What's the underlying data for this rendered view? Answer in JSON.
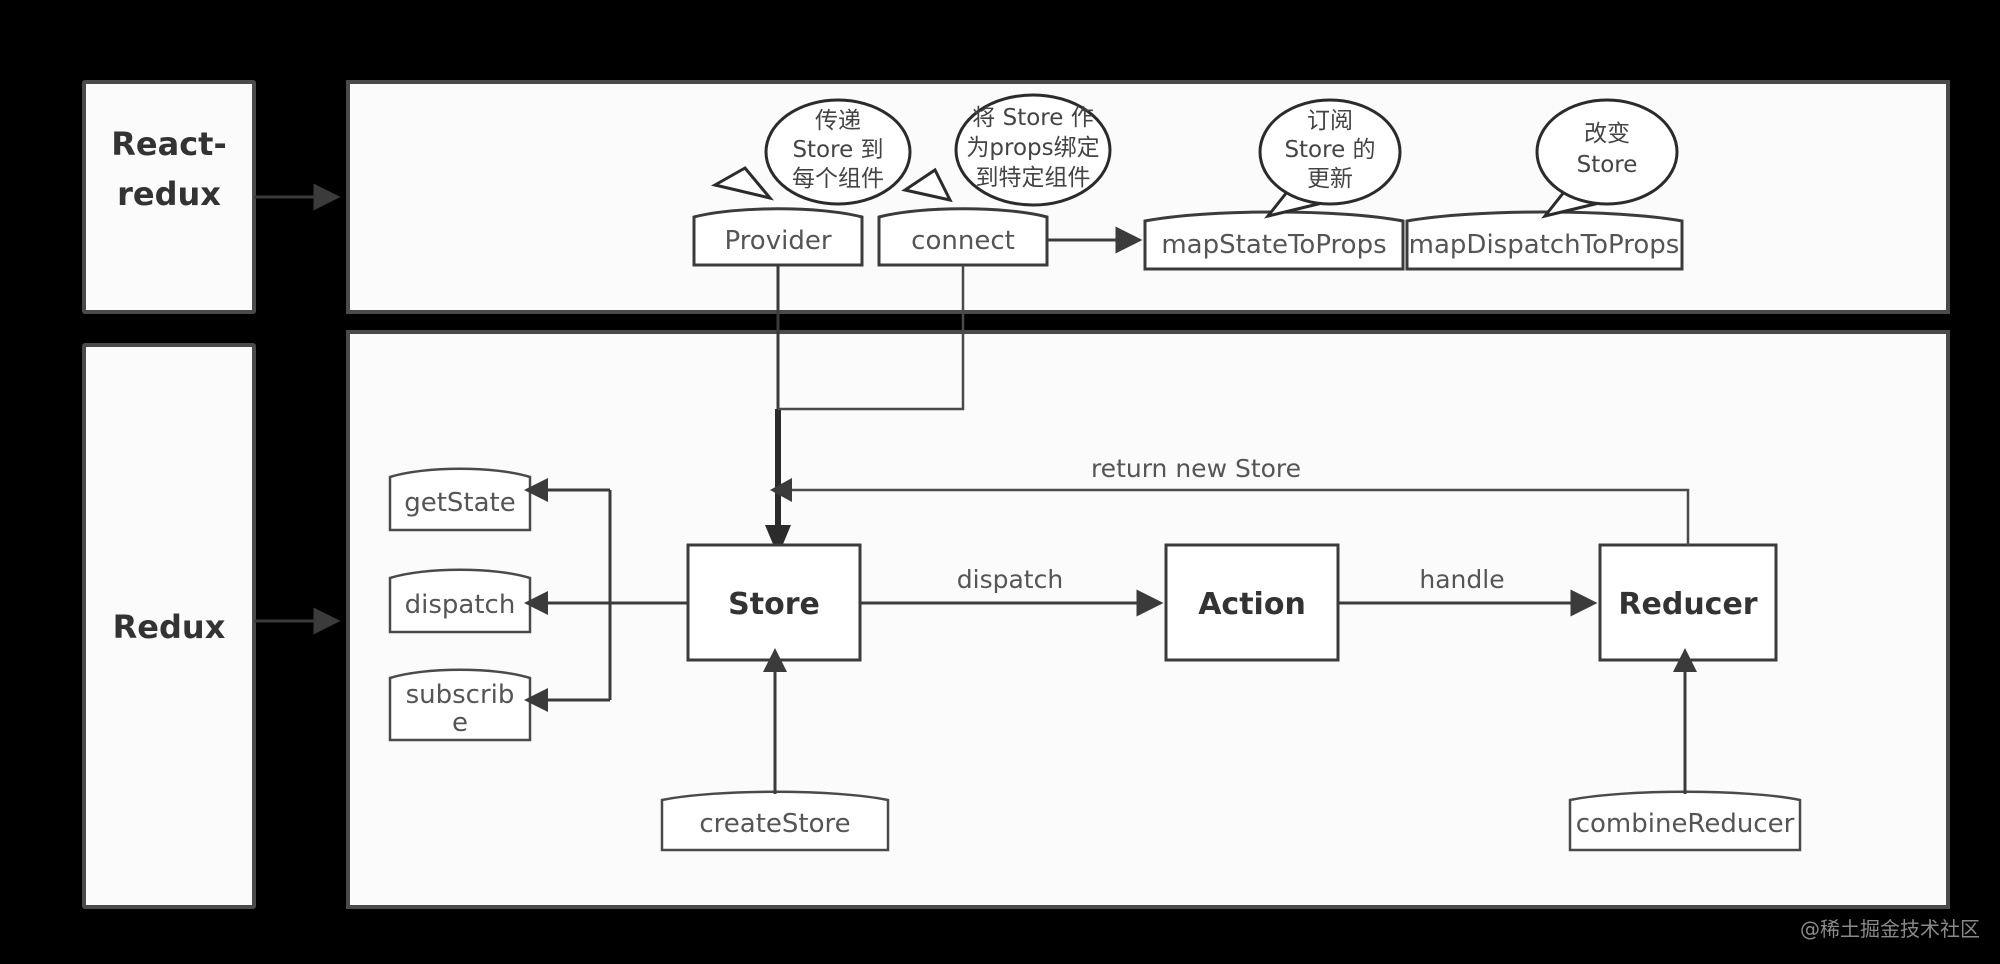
{
  "sections": [
    {
      "id": "react-redux",
      "label_line1": "React-",
      "label_line2": "redux"
    },
    {
      "id": "redux",
      "label_line1": "Redux",
      "label_line2": ""
    }
  ],
  "callouts": [
    {
      "id": "provider-note",
      "lines": [
        "传递",
        "Store 到",
        "每个组件"
      ]
    },
    {
      "id": "connect-note",
      "lines": [
        "将 Store 作",
        "为props绑定",
        "到特定组件"
      ]
    },
    {
      "id": "mapstate-note",
      "lines": [
        "订阅",
        "Store 的",
        "更新"
      ]
    },
    {
      "id": "mapdispatch-note",
      "lines": [
        "改变",
        "Store"
      ]
    }
  ],
  "react_redux_nodes": [
    {
      "id": "provider",
      "label": "Provider"
    },
    {
      "id": "connect",
      "label": "connect"
    },
    {
      "id": "mapStateToProps",
      "label": "mapStateToProps"
    },
    {
      "id": "mapDispatchToProps",
      "label": "mapDispatchToProps"
    }
  ],
  "redux_api_nodes": [
    {
      "id": "getState",
      "label": "getState"
    },
    {
      "id": "dispatch",
      "label": "dispatch"
    },
    {
      "id": "subscribe",
      "label_line1": "subscrib",
      "label_line2": "e"
    }
  ],
  "redux_flow_nodes": [
    {
      "id": "store",
      "label": "Store"
    },
    {
      "id": "action",
      "label": "Action"
    },
    {
      "id": "reducer",
      "label": "Reducer"
    }
  ],
  "redux_factory_nodes": [
    {
      "id": "createStore",
      "label": "createStore"
    },
    {
      "id": "combineReducer",
      "label": "combineReducer"
    }
  ],
  "edge_labels": [
    {
      "id": "dispatch-edge",
      "label": "dispatch"
    },
    {
      "id": "handle-edge",
      "label": "handle"
    },
    {
      "id": "return-edge",
      "label": "return new Store"
    }
  ],
  "watermark": {
    "text": "@稀土掘金技术社区"
  },
  "colors": {
    "background": "#000000",
    "panel_fill": "#fbfbfb",
    "box_fill": "#ffffff",
    "stroke": "#3b3b3b",
    "text": "#555555",
    "watermark": "#8a8a8a"
  }
}
